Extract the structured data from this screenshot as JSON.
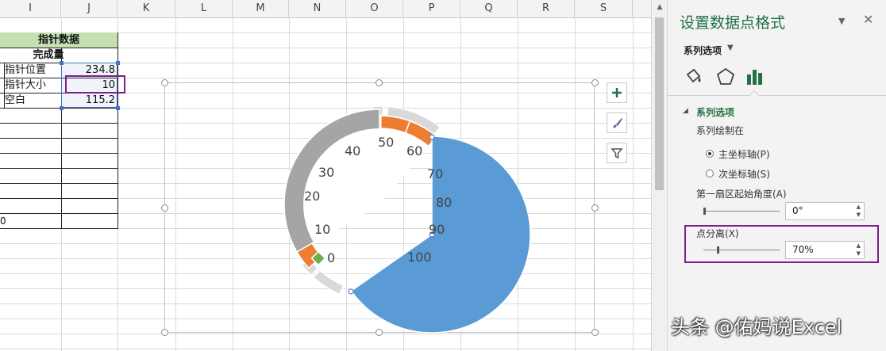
{
  "sheet": {
    "columns": [
      "I",
      "J",
      "K",
      "L",
      "M",
      "N",
      "O",
      "P",
      "Q",
      "R",
      "S"
    ],
    "table": {
      "title": "指针数据",
      "header": "完成量",
      "rows": [
        {
          "label": "指针位置",
          "value": "234.8"
        },
        {
          "label": "指针大小",
          "value": "10"
        },
        {
          "label": "空白",
          "value": "115.2"
        }
      ]
    },
    "edge_digit": "0"
  },
  "chart": {
    "ticks": [
      "0",
      "10",
      "20",
      "30",
      "40",
      "50",
      "60",
      "70",
      "80",
      "90",
      "100"
    ],
    "colors": {
      "gray": "#a5a5a5",
      "light_gray": "#d9d9d9",
      "orange": "#ed7d31",
      "blue": "#5b9bd5",
      "green": "#70ad47"
    },
    "tools": [
      "plus-icon",
      "brush-icon",
      "filter-icon"
    ]
  },
  "chart_data": {
    "type": "pie",
    "pointer_series": {
      "categories": [
        "指针位置",
        "指针大小",
        "空白"
      ],
      "values": [
        234.8,
        10,
        115.2
      ]
    },
    "point_explosion": "70%",
    "first_slice_angle": "0°"
  },
  "pane": {
    "title": "设置数据点格式",
    "series_options_menu": "系列选项",
    "tabs": [
      "fill-line-icon",
      "effects-icon",
      "series-options-icon"
    ],
    "section_title": "系列选项",
    "plot_on_label": "系列绘制在",
    "primary_axis": "主坐标轴(P)",
    "secondary_axis": "次坐标轴(S)",
    "first_slice_angle_label": "第一扇区起始角度(A)",
    "first_slice_angle_value": "0°",
    "explosion_label": "点分离(X)",
    "explosion_value": "70%"
  },
  "watermark": "头条 @佑妈说Excel"
}
